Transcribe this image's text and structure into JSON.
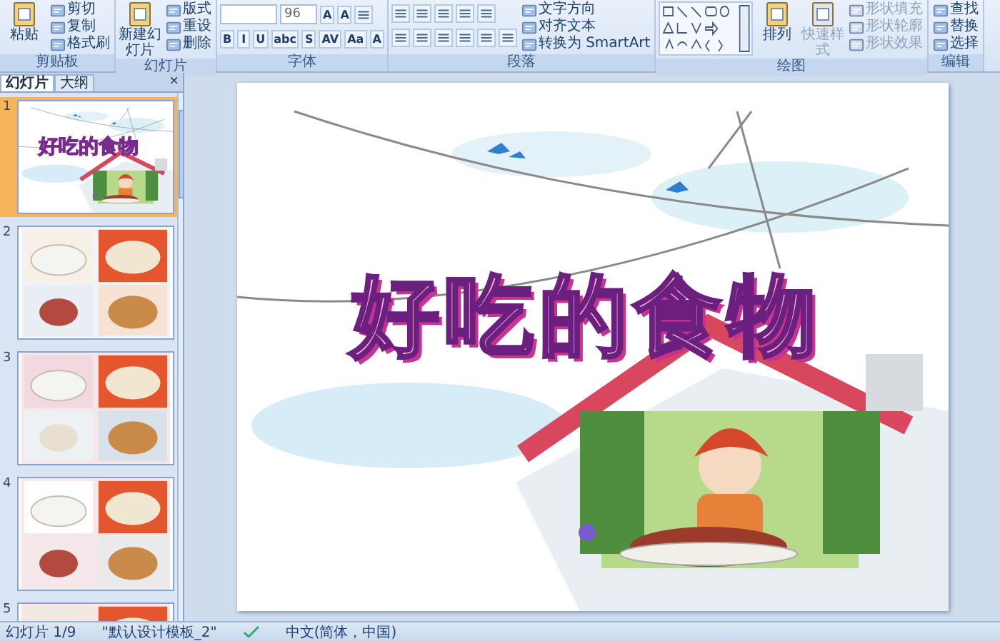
{
  "ribbon": {
    "groups": [
      {
        "label": "剪贴板",
        "blocks": [
          {
            "kind": "large",
            "label": "粘贴"
          },
          {
            "kind": "stack",
            "items": [
              {
                "label": "剪切"
              },
              {
                "label": "复制"
              },
              {
                "label": "格式刷"
              }
            ]
          }
        ]
      },
      {
        "label": "幻灯片",
        "blocks": [
          {
            "kind": "large",
            "label": "新建幻灯片"
          },
          {
            "kind": "stack",
            "items": [
              {
                "label": "版式"
              },
              {
                "label": "重设"
              },
              {
                "label": "删除"
              }
            ]
          }
        ]
      },
      {
        "label": "字体",
        "blocks": [
          {
            "kind": "rows",
            "top": [
              {
                "kind": "field"
              },
              {
                "kind": "field",
                "value": "96"
              },
              {
                "kind": "glyph",
                "label": "A"
              },
              {
                "kind": "glyph",
                "label": "A"
              },
              {
                "kind": "icon"
              }
            ],
            "bottom": [
              {
                "kind": "glyph",
                "label": "B"
              },
              {
                "kind": "glyph",
                "label": "I"
              },
              {
                "kind": "glyph",
                "label": "U"
              },
              {
                "kind": "glyph",
                "label": "abc"
              },
              {
                "kind": "glyph",
                "label": "S"
              },
              {
                "kind": "glyph",
                "label": "AV"
              },
              {
                "kind": "glyph",
                "label": "Aa"
              },
              {
                "kind": "glyph",
                "label": "A"
              }
            ]
          }
        ]
      },
      {
        "label": "段落",
        "blocks": [
          {
            "kind": "rows",
            "top": [
              {
                "kind": "icon"
              },
              {
                "kind": "icon"
              },
              {
                "kind": "icon"
              },
              {
                "kind": "icon"
              },
              {
                "kind": "icon"
              }
            ],
            "bottom": [
              {
                "kind": "icon"
              },
              {
                "kind": "icon"
              },
              {
                "kind": "icon"
              },
              {
                "kind": "icon"
              },
              {
                "kind": "icon"
              },
              {
                "kind": "icon"
              }
            ]
          },
          {
            "kind": "stack",
            "items": [
              {
                "label": "文字方向"
              },
              {
                "label": "对齐文本"
              },
              {
                "label": "转换为 SmartArt"
              }
            ]
          }
        ]
      },
      {
        "label": "绘图",
        "blocks": [
          {
            "kind": "shapes"
          },
          {
            "kind": "large",
            "label": "排列"
          },
          {
            "kind": "large",
            "label": "快速样式",
            "disabled": true
          },
          {
            "kind": "stack",
            "disabled": true,
            "items": [
              {
                "label": "形状填充"
              },
              {
                "label": "形状轮廓"
              },
              {
                "label": "形状效果"
              }
            ]
          }
        ]
      },
      {
        "label": "编辑",
        "blocks": [
          {
            "kind": "stack",
            "items": [
              {
                "label": "查找"
              },
              {
                "label": "替换"
              },
              {
                "label": "选择"
              }
            ]
          }
        ]
      }
    ]
  },
  "panel": {
    "tabs": [
      {
        "label": "幻灯片",
        "selected": true
      },
      {
        "label": "大纲",
        "selected": false
      }
    ],
    "close": "×",
    "thumbnails": [
      {
        "number": "1",
        "selected": true,
        "title": "好吃的食物"
      },
      {
        "number": "2",
        "selected": false
      },
      {
        "number": "3",
        "selected": false
      },
      {
        "number": "4",
        "selected": false
      },
      {
        "number": "5",
        "selected": false
      }
    ]
  },
  "slide": {
    "title": "好吃的食物"
  },
  "status_bar": {
    "slide": "幻灯片 1/9",
    "theme": "\"默认设计模板_2\"",
    "language": "中文(简体，中国)"
  }
}
